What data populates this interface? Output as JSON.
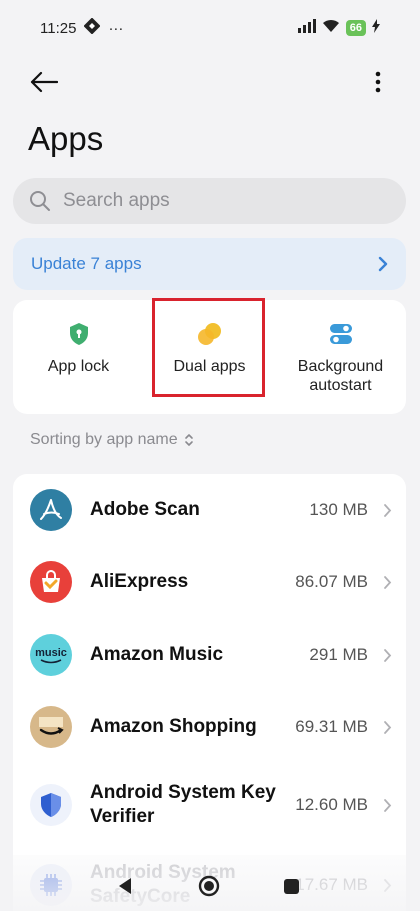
{
  "status_bar": {
    "time": "11:25",
    "dots": "···",
    "battery": "66"
  },
  "header": {
    "title": "Apps"
  },
  "search": {
    "placeholder": "Search apps"
  },
  "update_banner": {
    "label": "Update 7 apps"
  },
  "tools": [
    {
      "label": "App lock",
      "icon": "shield-lock-icon"
    },
    {
      "label": "Dual apps",
      "icon": "dual-circles-icon"
    },
    {
      "label": "Background autostart",
      "icon": "toggle-icon"
    }
  ],
  "sorting": {
    "label": "Sorting by app name"
  },
  "apps": [
    {
      "name": "Adobe Scan",
      "size": "130 MB",
      "icon": "adobe-scan-icon"
    },
    {
      "name": "AliExpress",
      "size": "86.07 MB",
      "icon": "aliexpress-icon"
    },
    {
      "name": "Amazon Music",
      "size": "291 MB",
      "icon": "amazon-music-icon"
    },
    {
      "name": "Amazon Shopping",
      "size": "69.31 MB",
      "icon": "amazon-shopping-icon"
    },
    {
      "name": "Android System Key Verifier",
      "size": "12.60 MB",
      "icon": "shield-icon"
    },
    {
      "name": "Android System SafetyCore",
      "size": "17.67 MB",
      "icon": "chip-icon"
    }
  ],
  "colors": {
    "accent": "#3a82d6",
    "highlight": "#d9232d",
    "dual_apps": "#f2c030",
    "app_lock": "#3fae6f"
  }
}
